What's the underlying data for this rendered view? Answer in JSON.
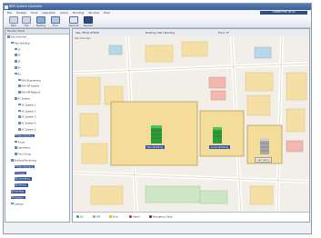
{
  "window": {
    "title": "BMS System Controller"
  },
  "menu": [
    "File",
    "Display",
    "Tools",
    "Operation",
    "Alarm",
    "Building",
    "Window",
    "Help"
  ],
  "status_text": "CONNECTED  00:00",
  "toolbar": [
    {
      "label": "Back",
      "icon": "arrow-left-icon"
    },
    {
      "label": "Fwd",
      "icon": "arrow-right-icon"
    },
    {
      "label": "Building",
      "icon": "building-icon"
    },
    {
      "label": "Floor",
      "icon": "floor-icon"
    },
    {
      "label": "Select All",
      "icon": "select-all-icon"
    },
    {
      "label": "Deselect",
      "icon": "deselect-icon"
    }
  ],
  "tree": {
    "header": "Monitor Mode",
    "nodes": [
      {
        "label": "Site Overview",
        "level": 0,
        "selected": false
      },
      {
        "label": "Main Building",
        "level": 1,
        "selected": false
      },
      {
        "label": "1F",
        "level": 2,
        "selected": false
      },
      {
        "label": "2F",
        "level": 2,
        "selected": false
      },
      {
        "label": "3F",
        "level": 2,
        "selected": false
      },
      {
        "label": "4F",
        "level": 2,
        "selected": false
      },
      {
        "label": "B1",
        "level": 2,
        "selected": false
      },
      {
        "label": "EHU-Engineering",
        "level": 3,
        "selected": false
      },
      {
        "label": "EHU-HP System",
        "level": 3,
        "selected": false
      },
      {
        "label": "EHU-HP Network",
        "level": 3,
        "selected": false
      },
      {
        "label": "AC System",
        "level": 2,
        "selected": false
      },
      {
        "label": "AC System 1",
        "level": 3,
        "selected": false
      },
      {
        "label": "AC System 2",
        "level": 3,
        "selected": false
      },
      {
        "label": "AC System 3",
        "level": 3,
        "selected": false
      },
      {
        "label": "AC System 4",
        "level": 3,
        "selected": false
      },
      {
        "label": "AC System 5",
        "level": 3,
        "selected": false
      },
      {
        "label": "Main Building",
        "level": 2,
        "selected": true
      },
      {
        "label": "Annex",
        "level": 2,
        "selected": false
      },
      {
        "label": "Laboratory",
        "level": 2,
        "selected": false
      },
      {
        "label": "Floor Group",
        "level": 2,
        "selected": false
      },
      {
        "label": "Building Monitoring",
        "level": 1,
        "selected": false
      },
      {
        "label": "Main Building",
        "level": 2,
        "selected": true
      },
      {
        "label": "Annex",
        "level": 2,
        "selected": true
      },
      {
        "label": "Laboratory",
        "level": 2,
        "selected": true
      },
      {
        "label": "Parking",
        "level": 2,
        "selected": true
      },
      {
        "label": "Site Map",
        "level": 1,
        "selected": true
      },
      {
        "label": "Outdoor",
        "level": 1,
        "selected": true
      },
      {
        "label": "Campus",
        "level": 1,
        "selected": false
      }
    ]
  },
  "main": {
    "site_label": "Site: HEAD OFFICE",
    "building_label": "Building: Main Building",
    "floor_label": "Floor: 1F",
    "map_caption": "Site Overview"
  },
  "buildings": [
    {
      "name": "Main Building",
      "color": "#2f9a3a"
    },
    {
      "name": "Annex Building",
      "color": "#2f9a3a"
    },
    {
      "name": "Laboratory",
      "color": "#a8a8a8"
    }
  ],
  "legend": [
    {
      "label": "On",
      "color": "#2faa3a"
    },
    {
      "label": "Off",
      "color": "#9aa0a8"
    },
    {
      "label": "Error",
      "color": "#e6b400"
    },
    {
      "label": "Alarm",
      "color": "#d42020"
    },
    {
      "label": "Emergency Stop",
      "color": "#7a1a1a"
    }
  ]
}
